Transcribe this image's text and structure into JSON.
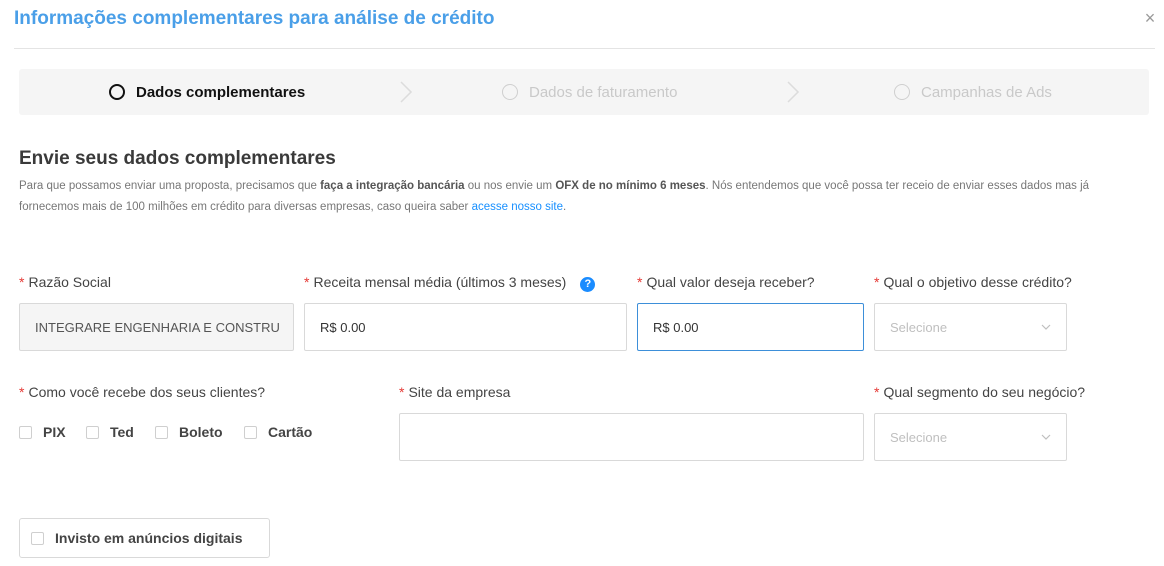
{
  "modal": {
    "title": "Informações complementares para análise de crédito",
    "close_icon": "×"
  },
  "steps": [
    {
      "label": "Dados complementares",
      "state": "active"
    },
    {
      "label": "Dados de faturamento",
      "state": "inactive"
    },
    {
      "label": "Campanhas de Ads",
      "state": "inactive"
    }
  ],
  "section": {
    "title": "Envie seus dados complementares",
    "desc_1": "Para que possamos enviar uma proposta, precisamos que ",
    "desc_bold_1": "faça a integração bancária",
    "desc_2": " ou nos envie um ",
    "desc_bold_2": "OFX de no mínimo 6 meses",
    "desc_3": ". Nós entendemos que você possa ter receio de enviar esses dados mas já fornecemos mais de 100 milhões em crédito para diversas empresas, caso queira saber ",
    "desc_link": "acesse nosso site",
    "desc_4": "."
  },
  "form": {
    "required_mark": "*",
    "razao_social": {
      "label": "Razão Social",
      "value": "INTEGRARE ENGENHARIA E CONSTRU"
    },
    "receita": {
      "label": "Receita mensal média (últimos 3 meses)",
      "value": "R$ 0.00",
      "help_icon": "?"
    },
    "valor": {
      "label": "Qual valor deseja receber?",
      "value": "R$ 0.00"
    },
    "objetivo": {
      "label": "Qual o objetivo desse crédito?",
      "placeholder": "Selecione"
    },
    "recebe": {
      "label": "Como você recebe dos seus clientes?",
      "options": [
        "PIX",
        "Ted",
        "Boleto",
        "Cartão"
      ]
    },
    "site": {
      "label": "Site da empresa",
      "value": ""
    },
    "segmento": {
      "label": "Qual segmento do seu negócio?",
      "placeholder": "Selecione"
    },
    "invest_label": "Invisto em anúncios digitais"
  },
  "colors": {
    "title": "#4a9fe8",
    "required": "#e53935",
    "link": "#1890ff",
    "focus_border": "#3d8fd9"
  }
}
